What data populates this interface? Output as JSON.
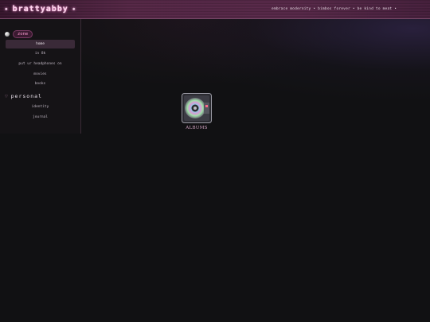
{
  "header": {
    "logo_text": "brattyabby",
    "sparkle_left": "✺",
    "sparkle_right": "✺",
    "marquee_text": "embrace modernity • bimbos forever • be kind to meat •"
  },
  "sidebar": {
    "zone_label": "zone",
    "zone_items": [
      {
        "label": "home",
        "active": true
      },
      {
        "label": "in 8k",
        "active": false
      },
      {
        "label": "put ur headphones on",
        "active": false
      },
      {
        "label": "movies",
        "active": false
      },
      {
        "label": "books",
        "active": false
      }
    ],
    "personal_icon": "♡",
    "personal_label": "personal",
    "personal_items": [
      {
        "label": "identity"
      },
      {
        "label": "journal"
      }
    ]
  },
  "main": {
    "album_tile": {
      "icon": "cd-disc-icon",
      "caption": "ALBUMS"
    }
  },
  "colors": {
    "header_bg": "#5a2a4a",
    "accent_pink": "#ff9fd4",
    "page_bg": "#111113"
  }
}
